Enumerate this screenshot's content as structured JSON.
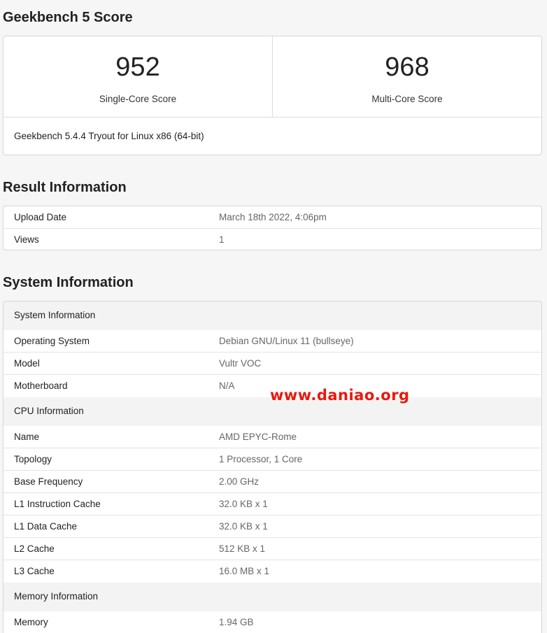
{
  "score_section": {
    "title": "Geekbench 5 Score",
    "single_core": {
      "value": "952",
      "label": "Single-Core Score"
    },
    "multi_core": {
      "value": "968",
      "label": "Multi-Core Score"
    },
    "version": "Geekbench 5.4.4 Tryout for Linux x86 (64-bit)"
  },
  "result_section": {
    "title": "Result Information",
    "rows": [
      {
        "key": "Upload Date",
        "value": "March 18th 2022, 4:06pm"
      },
      {
        "key": "Views",
        "value": "1"
      }
    ]
  },
  "system_section": {
    "title": "System Information",
    "groups": [
      {
        "heading": "System Information",
        "rows": [
          {
            "key": "Operating System",
            "value": "Debian GNU/Linux 11 (bullseye)"
          },
          {
            "key": "Model",
            "value": "Vultr VOC"
          },
          {
            "key": "Motherboard",
            "value": "N/A"
          }
        ]
      },
      {
        "heading": "CPU Information",
        "rows": [
          {
            "key": "Name",
            "value": "AMD EPYC-Rome"
          },
          {
            "key": "Topology",
            "value": "1 Processor, 1 Core"
          },
          {
            "key": "Base Frequency",
            "value": "2.00 GHz"
          },
          {
            "key": "L1 Instruction Cache",
            "value": "32.0 KB x 1"
          },
          {
            "key": "L1 Data Cache",
            "value": "32.0 KB x 1"
          },
          {
            "key": "L2 Cache",
            "value": "512 KB x 1"
          },
          {
            "key": "L3 Cache",
            "value": "16.0 MB x 1"
          }
        ]
      },
      {
        "heading": "Memory Information",
        "rows": [
          {
            "key": "Memory",
            "value": "1.94 GB"
          }
        ]
      }
    ]
  },
  "watermark": {
    "text": "www.daniao.org",
    "color": "#e8190d"
  }
}
